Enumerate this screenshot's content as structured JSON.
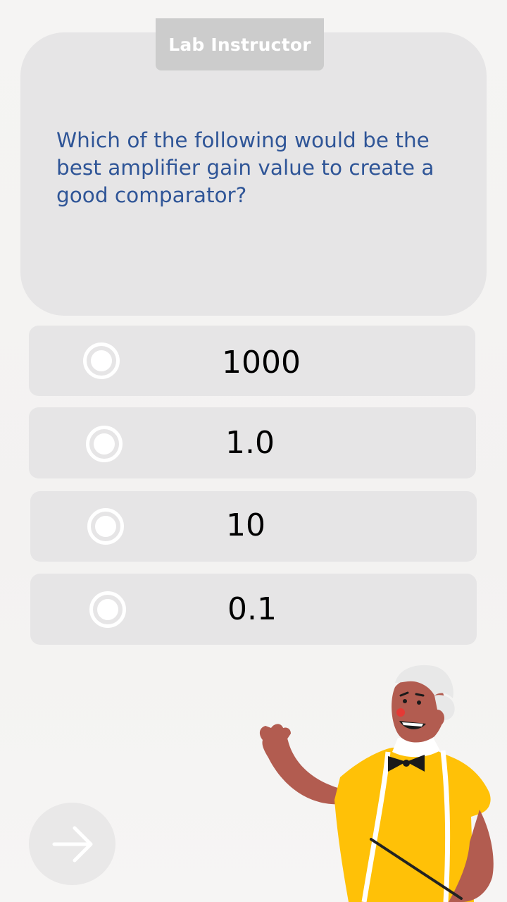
{
  "speaker": {
    "label": "Lab Instructor"
  },
  "question": {
    "text": "Which of the following would be the best amplifier gain value to create a good comparator?"
  },
  "options": [
    {
      "label": "1000"
    },
    {
      "label": "1.0"
    },
    {
      "label": "10"
    },
    {
      "label": "0.1"
    }
  ],
  "colors": {
    "question_text": "#2f5597",
    "card": "#e6e5e6",
    "speaker_tab": "#cccccc",
    "shirt": "#ffc107",
    "skin": "#b25c50"
  },
  "icons": {
    "next": "arrow-right-icon",
    "radio": "radio-button-icon",
    "character": "instructor-illustration"
  }
}
